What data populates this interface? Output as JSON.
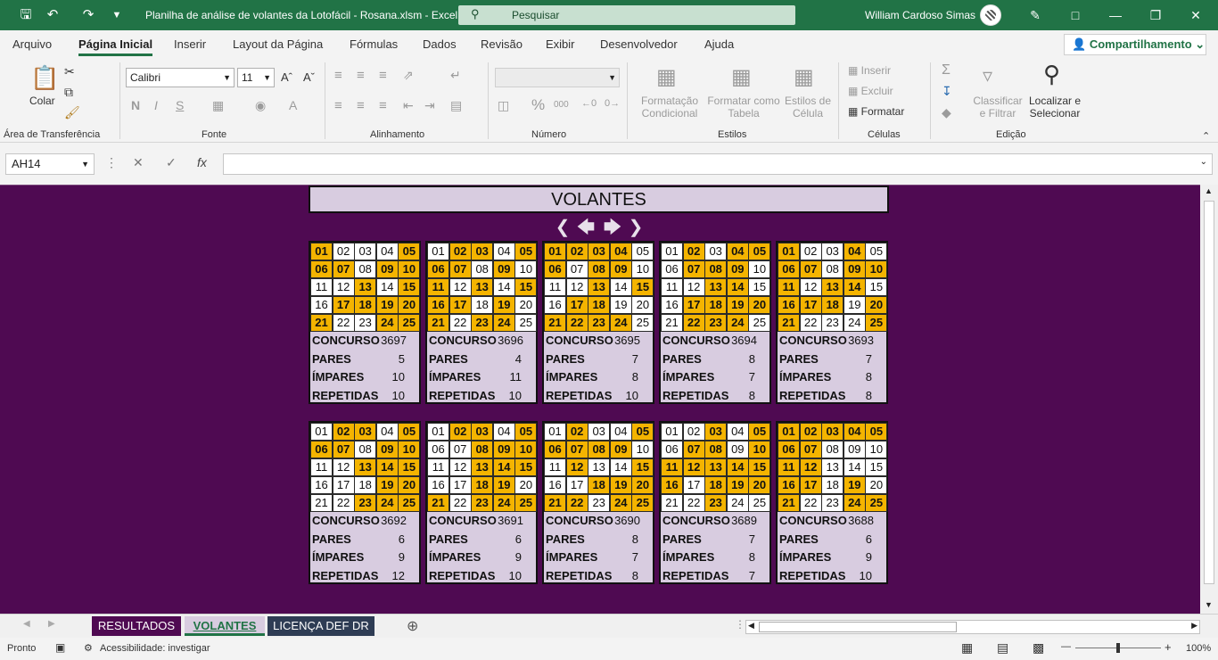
{
  "title_bar": {
    "document_title": "Planilha de análise de volantes da Lotofácil - Rosana.xlsm  -  Excel",
    "search_placeholder": "Pesquisar",
    "user_name": "William Cardoso Simas"
  },
  "menu": {
    "tabs": [
      "Arquivo",
      "Página Inicial",
      "Inserir",
      "Layout da Página",
      "Fórmulas",
      "Dados",
      "Revisão",
      "Exibir",
      "Desenvolvedor",
      "Ajuda"
    ],
    "active_tab": "Página Inicial",
    "share_label": "Compartilhamento"
  },
  "ribbon": {
    "clipboard": {
      "paste": "Colar",
      "group": "Área de Transferência"
    },
    "font": {
      "name": "Calibri",
      "size": "11",
      "bold": "N",
      "italic": "I",
      "underline": "S",
      "group": "Fonte"
    },
    "alignment": {
      "group": "Alinhamento"
    },
    "number": {
      "group": "Número"
    },
    "styles": {
      "conditional": [
        "Formatação",
        "Condicional"
      ],
      "table": [
        "Formatar como",
        "Tabela"
      ],
      "cell": [
        "Estilos de",
        "Célula"
      ],
      "group": "Estilos"
    },
    "cells": {
      "insert": "Inserir",
      "delete": "Excluir",
      "format": "Formatar",
      "group": "Células"
    },
    "editing": {
      "sort": [
        "Classificar",
        "e Filtrar"
      ],
      "find": [
        "Localizar e",
        "Selecionar"
      ],
      "group": "Edição"
    }
  },
  "formula_bar": {
    "name_box": "AH14",
    "fx": "fx",
    "value": ""
  },
  "sheet": {
    "header": "VOLANTES",
    "labels": {
      "concurso": "CONCURSO",
      "pares": "PARES",
      "impares": "ÍMPARES",
      "repetidas": "REPETIDAS"
    },
    "cards": [
      {
        "concurso": 3697,
        "pares": 5,
        "impares": 10,
        "repetidas": 10,
        "drawn": [
          1,
          5,
          6,
          7,
          9,
          10,
          13,
          15,
          17,
          18,
          19,
          20,
          21,
          24,
          25
        ]
      },
      {
        "concurso": 3696,
        "pares": 4,
        "impares": 11,
        "repetidas": 10,
        "drawn": [
          2,
          3,
          5,
          6,
          7,
          9,
          11,
          13,
          15,
          16,
          17,
          19,
          21,
          23,
          24
        ]
      },
      {
        "concurso": 3695,
        "pares": 7,
        "impares": 8,
        "repetidas": 10,
        "drawn": [
          1,
          2,
          3,
          4,
          6,
          8,
          9,
          13,
          15,
          17,
          18,
          21,
          22,
          23,
          24
        ]
      },
      {
        "concurso": 3694,
        "pares": 8,
        "impares": 7,
        "repetidas": 8,
        "drawn": [
          2,
          4,
          5,
          7,
          8,
          9,
          13,
          14,
          17,
          18,
          19,
          20,
          22,
          23,
          24
        ]
      },
      {
        "concurso": 3693,
        "pares": 7,
        "impares": 8,
        "repetidas": 8,
        "drawn": [
          1,
          4,
          6,
          7,
          9,
          10,
          11,
          13,
          14,
          16,
          17,
          18,
          20,
          21,
          25
        ]
      },
      {
        "concurso": 3692,
        "pares": 6,
        "impares": 9,
        "repetidas": 12,
        "drawn": [
          2,
          3,
          5,
          6,
          7,
          9,
          10,
          13,
          14,
          15,
          19,
          20,
          23,
          24,
          25
        ]
      },
      {
        "concurso": 3691,
        "pares": 6,
        "impares": 9,
        "repetidas": 10,
        "drawn": [
          2,
          3,
          5,
          8,
          9,
          10,
          13,
          14,
          15,
          18,
          19,
          21,
          23,
          24,
          25
        ]
      },
      {
        "concurso": 3690,
        "pares": 8,
        "impares": 7,
        "repetidas": 8,
        "drawn": [
          2,
          5,
          6,
          7,
          8,
          9,
          12,
          15,
          18,
          19,
          20,
          21,
          22,
          24,
          25
        ]
      },
      {
        "concurso": 3689,
        "pares": 7,
        "impares": 8,
        "repetidas": 7,
        "drawn": [
          3,
          5,
          7,
          8,
          10,
          11,
          12,
          13,
          14,
          15,
          16,
          18,
          19,
          20,
          23
        ]
      },
      {
        "concurso": 3688,
        "pares": 6,
        "impares": 9,
        "repetidas": 10,
        "drawn": [
          1,
          2,
          3,
          4,
          5,
          6,
          7,
          11,
          12,
          16,
          17,
          19,
          21,
          24,
          25
        ]
      }
    ]
  },
  "sheet_tabs": [
    {
      "label": "RESULTADOS",
      "bg": "#4f0a52",
      "color": "#ffffff"
    },
    {
      "label": "VOLANTES",
      "bg": "#d8cce0",
      "color": "#217346"
    },
    {
      "label": "LICENÇA DEF DR",
      "bg": "#2e3c54",
      "color": "#ffffff"
    }
  ],
  "status": {
    "ready": "Pronto",
    "accessibility": "Acessibilidade: investigar",
    "zoom": "100%"
  },
  "colors": {
    "accent": "#217346",
    "sheet_bg": "#4f0a52",
    "drawn": "#f4b400",
    "card_bg": "#d8cce0"
  }
}
